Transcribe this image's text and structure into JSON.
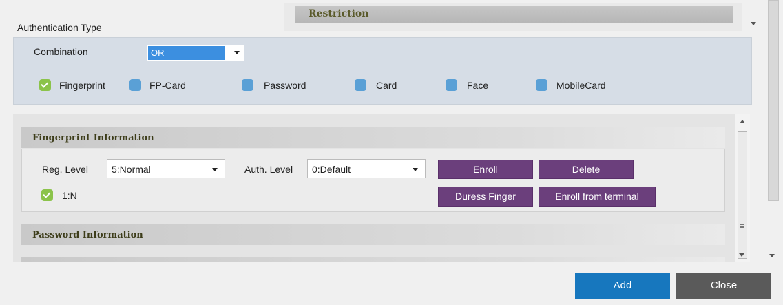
{
  "tabs": {
    "restriction": "Restriction"
  },
  "auth_type": {
    "title": "Authentication Type",
    "combination_label": "Combination",
    "combination_value": "OR",
    "options": [
      {
        "label": "Fingerprint",
        "checked": true
      },
      {
        "label": "FP-Card",
        "checked": false
      },
      {
        "label": "Password",
        "checked": false
      },
      {
        "label": "Card",
        "checked": false
      },
      {
        "label": "Face",
        "checked": false
      },
      {
        "label": "MobileCard",
        "checked": false
      }
    ]
  },
  "fingerprint": {
    "header": "Fingerprint Information",
    "reg_level_label": "Reg. Level",
    "reg_level_value": "5:Normal",
    "auth_level_label": "Auth. Level",
    "auth_level_value": "0:Default",
    "one_to_n_label": "1:N",
    "one_to_n_checked": true,
    "buttons": {
      "enroll": "Enroll",
      "delete": "Delete",
      "duress": "Duress Finger",
      "enroll_terminal": "Enroll from terminal"
    }
  },
  "password": {
    "header": "Password Information"
  },
  "footer": {
    "add": "Add",
    "close": "Close"
  },
  "colors": {
    "accent_blue": "#1777be",
    "purple_button": "#6b3f7c",
    "check_green": "#8bc34a",
    "check_blue": "#5aa0d6",
    "close_gray": "#5a5a5a"
  }
}
